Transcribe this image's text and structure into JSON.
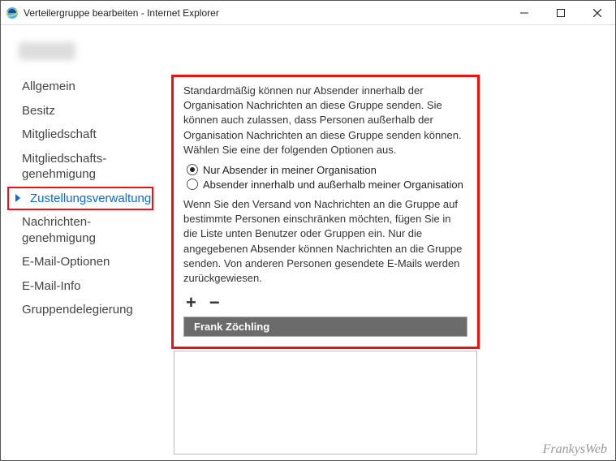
{
  "window": {
    "title": "Verteilergruppe bearbeiten - Internet Explorer"
  },
  "sidebar": {
    "items": [
      {
        "label": "Allgemein",
        "selected": false
      },
      {
        "label": "Besitz",
        "selected": false
      },
      {
        "label": "Mitgliedschaft",
        "selected": false
      },
      {
        "label": "Mitgliedschafts-\ngenehmigung",
        "selected": false
      },
      {
        "label": "Zustellungsverwaltung",
        "selected": true
      },
      {
        "label": "Nachrichten-\ngenehmigung",
        "selected": false
      },
      {
        "label": "E-Mail-Optionen",
        "selected": false
      },
      {
        "label": "E-Mail-Info",
        "selected": false
      },
      {
        "label": "Gruppendelegierung",
        "selected": false
      }
    ]
  },
  "panel": {
    "desc1": "Standardmäßig können nur Absender innerhalb der Organisation Nachrichten an diese Gruppe senden. Sie können auch zulassen, dass Personen außerhalb der Organisation Nachrichten an diese Gruppe senden können. Wählen Sie eine der folgenden Optionen aus.",
    "option1": "Nur Absender in meiner Organisation",
    "option2": "Absender innerhalb und außerhalb meiner Organisation",
    "selected_option": 1,
    "desc2": "Wenn Sie den Versand von Nachrichten an die Gruppe auf bestimmte Personen einschränken möchten, fügen Sie in die Liste unten Benutzer oder Gruppen ein. Nur die angegebenen Absender können Nachrichten an die Gruppe senden. Von anderen Personen gesendete E-Mails werden zurückgewiesen.",
    "add_glyph": "+",
    "remove_glyph": "−",
    "list": [
      {
        "name": "Frank Zöchling"
      }
    ]
  },
  "watermark": "FrankysWeb"
}
